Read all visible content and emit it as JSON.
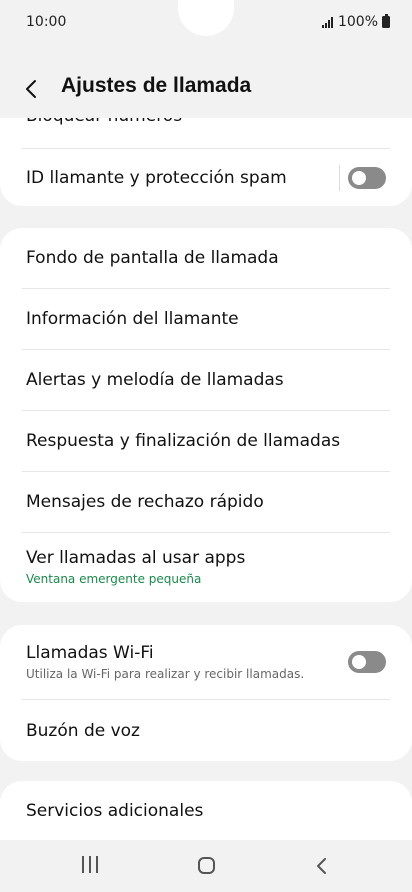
{
  "status": {
    "time": "10:00",
    "battery": "100%"
  },
  "header": {
    "title": "Ajustes de llamada"
  },
  "sections": {
    "first": {
      "partial_label": "Bloquear números",
      "caller_id": "ID llamante y protección spam"
    },
    "second": {
      "items": [
        "Fondo de pantalla de llamada",
        "Información del llamante",
        "Alertas y melodía de llamadas",
        "Respuesta y finalización de llamadas",
        "Mensajes de rechazo rápido"
      ],
      "popup_label": "Ver llamadas al usar apps",
      "popup_sub": "Ventana emergente pequeña"
    },
    "third": {
      "wifi_label": "Llamadas Wi-Fi",
      "wifi_sub": "Utiliza la Wi-Fi para realizar y recibir llamadas.",
      "voicemail": "Buzón de voz"
    },
    "fourth": {
      "additional": "Servicios adicionales"
    }
  },
  "toggles": {
    "caller_id_enabled": false,
    "wifi_calling_enabled": false
  },
  "colors": {
    "accent_green": "#1a8a4a",
    "toggle_off": "#8a8a8a"
  }
}
